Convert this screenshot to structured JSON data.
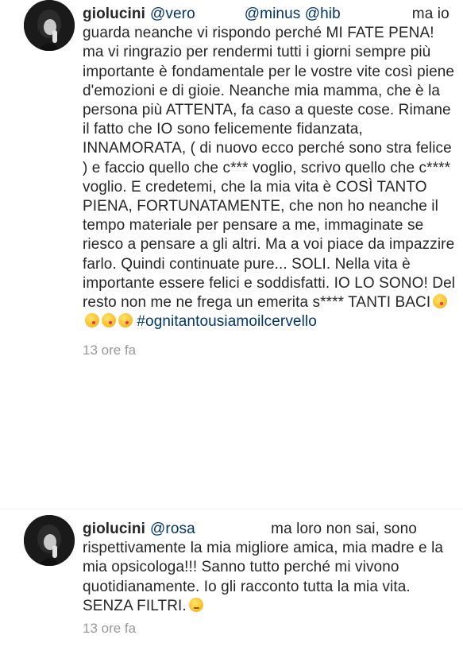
{
  "comments": [
    {
      "username": "giolucini",
      "mention_1": "@vero",
      "mention_2": "@minus",
      "mention_3": "@hib",
      "body": "ma io guarda neanche vi rispondo perché MI FATE PENA! ma vi ringrazio per rendermi tutti i giorni sempre più importante è fondamentale per le vostre vite così piene d'emozioni e di gioie. Neanche mia mamma, che è la persona più ATTENTA, fa caso a queste cose. Rimane il fatto che IO sono felicemente fidanzata, INNAMORATA, ( di nuovo ecco perché sono stra felice ) e faccio quello che c*** voglio, scrivo quello che c**** voglio. E credetemi, che la mia vita è COSÌ TANTO PIENA, FORTUNATAMENTE, che non ho neanche il tempo materiale per pensare a me, immaginate se riesco a pensare a gli altri. Ma a voi piace da impazzire farlo. Quindi continuate pure... SOLI. Nella vita è importante essere felici e soddisfatti. IO LO SONO! Del resto non me ne frega un emerita s**** TANTI BACI",
      "emoji_name": "kissing-face-icon",
      "hashtag": "#ognitantousiamoilcervello",
      "timestamp": "13 ore fa"
    },
    {
      "username": "giolucini",
      "mention_1": "@rosa",
      "body": "ma loro non sai, sono rispettivamente la mia migliore amica, mia madre e la mia opsicologa!!! Sanno tutto perché mi vivono quotidianamente. Io gli racconto tutta la mia vita. SENZA FILTRI.",
      "emoji_name": "smirking-face-icon",
      "timestamp": "13 ore fa"
    }
  ]
}
